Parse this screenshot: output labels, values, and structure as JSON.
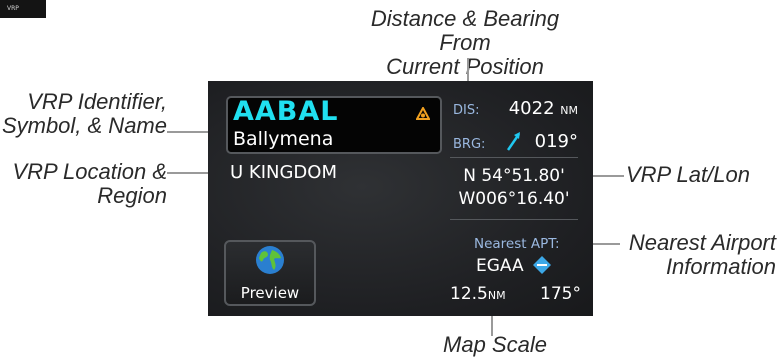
{
  "corner_tag": "VRP",
  "callouts": {
    "distance_line1": "Distance & Bearing From",
    "distance_line2": "Current Position",
    "identifier_line1": "VRP Identifier,",
    "identifier_line2": "Symbol, & Name",
    "location_line1": "VRP Location &",
    "location_line2": "Region",
    "latlon": "VRP Lat/Lon",
    "nearest_line1": "Nearest Airport",
    "nearest_line2": "Information",
    "map_scale": "Map Scale"
  },
  "vrp": {
    "identifier": "AABAL",
    "name": "Ballymena",
    "region": "U KINGDOM",
    "symbol_icon": "vrp-symbol-icon"
  },
  "distance": {
    "label": "DIS:",
    "value": "4022",
    "unit": "NM"
  },
  "bearing": {
    "label": "BRG:",
    "value": "019°",
    "icon": "bearing-arrow-icon"
  },
  "position": {
    "lat": "N 54°51.80'",
    "lon": "W006°16.40'"
  },
  "nearest": {
    "label": "Nearest APT:",
    "ident": "EGAA",
    "icon": "airport-icon",
    "distance": "12.5",
    "distance_unit": "NM",
    "bearing": "175°"
  },
  "preview_button": {
    "label": "Preview",
    "icon": "globe-icon"
  },
  "colors": {
    "identifier": "#20e0f0",
    "label": "#9ab8e0",
    "symbol": "#f0a020",
    "airport": "#3ca8e8",
    "background": "#1e1f22"
  }
}
